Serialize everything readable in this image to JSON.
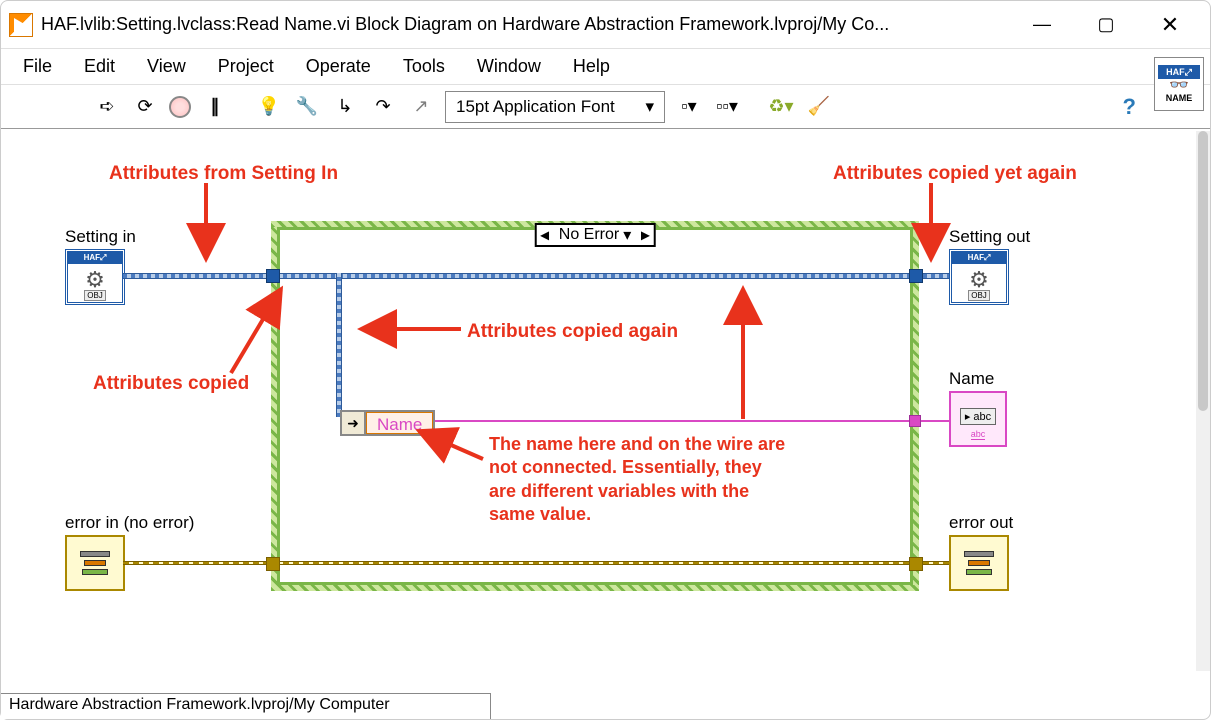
{
  "window": {
    "title": "HAF.lvlib:Setting.lvclass:Read Name.vi Block Diagram on Hardware Abstraction Framework.lvproj/My Co..."
  },
  "menu": {
    "file": "File",
    "edit": "Edit",
    "view": "View",
    "project": "Project",
    "operate": "Operate",
    "tools": "Tools",
    "window": "Window",
    "help": "Help"
  },
  "toolbar": {
    "font": "15pt Application Font"
  },
  "icon_panel": {
    "banner": "HAF⤢",
    "label": "NAME"
  },
  "case": {
    "selector": "No Error"
  },
  "terminals": {
    "setting_in_label": "Setting in",
    "setting_out_label": "Setting out",
    "name_label": "Name",
    "error_in_label": "error in (no error)",
    "error_out_label": "error out",
    "haf_banner": "HAF⤢",
    "obj": "OBJ",
    "abc": "abc"
  },
  "unbundle": {
    "field": "Name"
  },
  "annotations": {
    "a1": "Attributes from Setting In",
    "a2": "Attributes copied yet again",
    "a3": "Attributes copied",
    "a4": "Attributes copied again",
    "a5": "The name here and on the wire are not connected.  Essentially, they are different variables with the same value."
  },
  "status": {
    "text": "Hardware Abstraction Framework.lvproj/My Computer"
  }
}
